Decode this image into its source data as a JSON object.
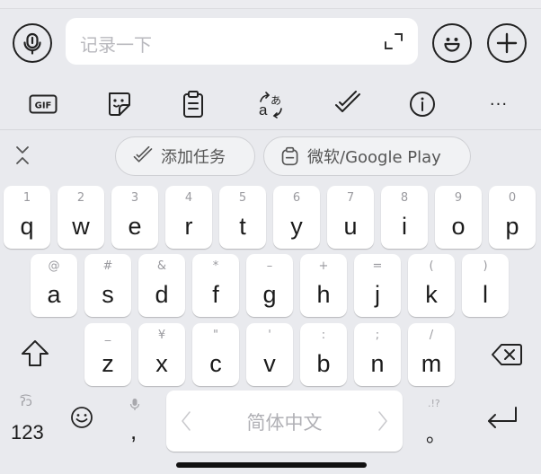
{
  "input": {
    "placeholder": "记录一下"
  },
  "toolbar": {
    "gif_label": "GIF",
    "more_label": "···"
  },
  "suggestions": [
    {
      "label": "添加任务",
      "icon": "check-pen-icon"
    },
    {
      "label": "微软/Google Play",
      "icon": "clipboard-icon"
    }
  ],
  "keys": {
    "row1": [
      {
        "hint": "1",
        "main": "q"
      },
      {
        "hint": "2",
        "main": "w"
      },
      {
        "hint": "3",
        "main": "e"
      },
      {
        "hint": "4",
        "main": "r"
      },
      {
        "hint": "5",
        "main": "t"
      },
      {
        "hint": "6",
        "main": "y"
      },
      {
        "hint": "7",
        "main": "u"
      },
      {
        "hint": "8",
        "main": "i"
      },
      {
        "hint": "9",
        "main": "o"
      },
      {
        "hint": "0",
        "main": "p"
      }
    ],
    "row2": [
      {
        "hint": "@",
        "main": "a"
      },
      {
        "hint": "#",
        "main": "s"
      },
      {
        "hint": "&",
        "main": "d"
      },
      {
        "hint": "*",
        "main": "f"
      },
      {
        "hint": "–",
        "main": "g"
      },
      {
        "hint": "+",
        "main": "h"
      },
      {
        "hint": "=",
        "main": "j"
      },
      {
        "hint": "(",
        "main": "k"
      },
      {
        "hint": ")",
        "main": "l"
      }
    ],
    "row3": [
      {
        "hint": "_",
        "main": "z"
      },
      {
        "hint": "¥",
        "main": "x"
      },
      {
        "hint": "\"",
        "main": "c"
      },
      {
        "hint": "'",
        "main": "v"
      },
      {
        "hint": ":",
        "main": "b"
      },
      {
        "hint": ";",
        "main": "n"
      },
      {
        "hint": "/",
        "main": "m"
      }
    ],
    "row4": {
      "numbers_hint": "ʔ͡ɔ",
      "numbers_label": "123",
      "comma_label": ",",
      "space_label": "简体中文",
      "period_hint": ".!?",
      "period_label": "。"
    }
  }
}
